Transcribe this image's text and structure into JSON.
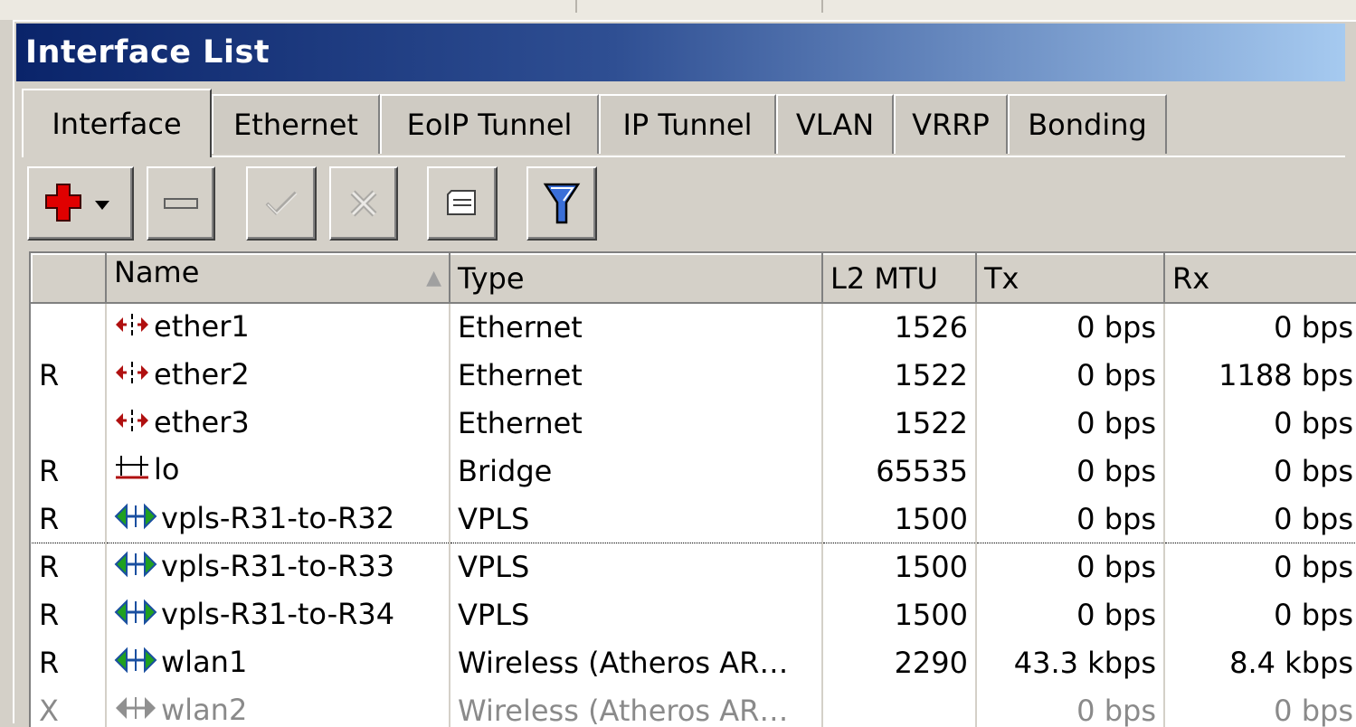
{
  "window": {
    "title": "Interface List"
  },
  "tabs": [
    {
      "label": "Interface",
      "active": true
    },
    {
      "label": "Ethernet"
    },
    {
      "label": "EoIP Tunnel"
    },
    {
      "label": "IP Tunnel"
    },
    {
      "label": "VLAN"
    },
    {
      "label": "VRRP"
    },
    {
      "label": "Bonding"
    }
  ],
  "toolbar": {
    "buttons": [
      {
        "name": "add-button",
        "icon": "plus-dropdown-icon",
        "enabled": true
      },
      {
        "name": "remove-button",
        "icon": "minus-icon",
        "enabled": true
      },
      {
        "name": "enable-button",
        "icon": "check-icon",
        "enabled": false
      },
      {
        "name": "disable-button",
        "icon": "x-icon",
        "enabled": false
      },
      {
        "name": "comment-button",
        "icon": "comment-icon",
        "enabled": true
      },
      {
        "name": "filter-button",
        "icon": "filter-icon",
        "enabled": true
      }
    ]
  },
  "table": {
    "columns": [
      "",
      "Name",
      "Type",
      "L2 MTU",
      "Tx",
      "Rx"
    ],
    "rows": [
      {
        "flag": "",
        "name": "ether1",
        "icon": "ethernet-icon",
        "type": "Ethernet",
        "l2mtu": "1526",
        "tx": "0 bps",
        "rx": "0 bps"
      },
      {
        "flag": "R",
        "name": "ether2",
        "icon": "ethernet-icon",
        "type": "Ethernet",
        "l2mtu": "1522",
        "tx": "0 bps",
        "rx": "1188 bps"
      },
      {
        "flag": "",
        "name": "ether3",
        "icon": "ethernet-icon",
        "type": "Ethernet",
        "l2mtu": "1522",
        "tx": "0 bps",
        "rx": "0 bps"
      },
      {
        "flag": "R",
        "name": "lo",
        "icon": "bridge-icon",
        "type": "Bridge",
        "l2mtu": "65535",
        "tx": "0 bps",
        "rx": "0 bps"
      },
      {
        "flag": "R",
        "name": "vpls-R31-to-R32",
        "icon": "tunnel-icon",
        "type": "VPLS",
        "l2mtu": "1500",
        "tx": "0 bps",
        "rx": "0 bps",
        "focused": true
      },
      {
        "flag": "R",
        "name": "vpls-R31-to-R33",
        "icon": "tunnel-icon",
        "type": "VPLS",
        "l2mtu": "1500",
        "tx": "0 bps",
        "rx": "0 bps"
      },
      {
        "flag": "R",
        "name": "vpls-R31-to-R34",
        "icon": "tunnel-icon",
        "type": "VPLS",
        "l2mtu": "1500",
        "tx": "0 bps",
        "rx": "0 bps"
      },
      {
        "flag": "R",
        "name": "wlan1",
        "icon": "wireless-icon",
        "type": "Wireless (Atheros AR…",
        "l2mtu": "2290",
        "tx": "43.3 kbps",
        "rx": "8.4 kbps"
      },
      {
        "flag": "X",
        "name": "wlan2",
        "icon": "wireless-icon",
        "type": "Wireless (Atheros AR…",
        "l2mtu": "",
        "tx": "0 bps",
        "rx": "0 bps",
        "disabled": true
      }
    ]
  },
  "colors": {
    "title_gradient_start": "#0a246a",
    "title_gradient_end": "#a6caf0",
    "face": "#d4d0c8",
    "disabled_text": "#8a8a8a",
    "add_icon": "#e00000"
  }
}
